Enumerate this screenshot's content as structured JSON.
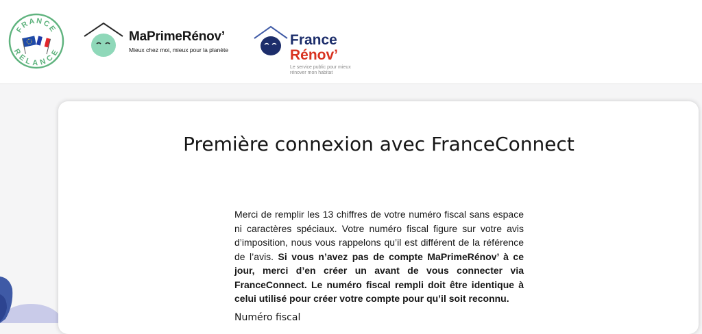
{
  "header": {
    "relance_logo": {
      "top_text": "FRANCE",
      "bottom_text": "RELANCE"
    },
    "maprimerenov_logo": {
      "name": "MaPrimeRénov’",
      "tagline": "Mieux chez moi, mieux pour la planète"
    },
    "francerenov_logo": {
      "line1": "France",
      "line2": "Rénov’",
      "tagline": "Le service public pour mieux rénover mon habitat"
    }
  },
  "main": {
    "title": "Première connexion avec FranceConnect",
    "intro": {
      "normal": "Merci de remplir les 13 chiffres de votre numéro fiscal sans espace ni caractères spéciaux. Votre numéro fiscal figure sur votre avis d’imposition, nous vous rappelons qu’il est différent de la référence de l’avis. ",
      "bold": "Si vous n’avez pas de compte MaPrimeRénov’ à ce jour, merci d’en créer un avant de vous connecter via FranceConnect. Le numéro fiscal rempli doit être identique à celui utilisé pour créer votre compte pour qu’il soit reconnu."
    },
    "field_label": "Numéro fiscal"
  },
  "colors": {
    "relance_green": "#5fb37e",
    "mpr_mint": "#8fd8b9",
    "fr_navy": "#1d2e6b",
    "fr_red": "#d8321f",
    "page_bg": "#f5f5f6"
  }
}
